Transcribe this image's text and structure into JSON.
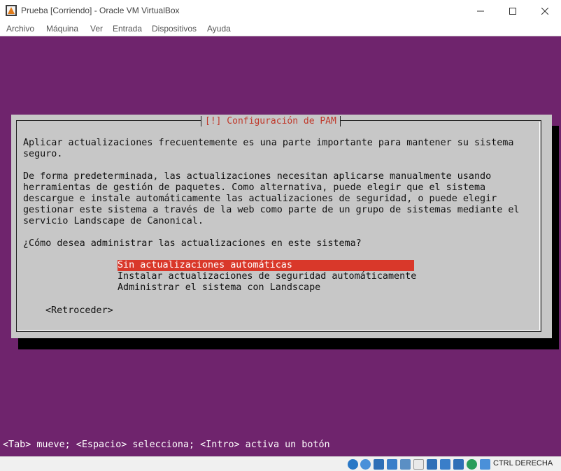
{
  "window": {
    "title": "Prueba [Corriendo] - Oracle VM VirtualBox",
    "minimize_glyph": "─",
    "maximize_glyph": "☐",
    "close_glyph": "✕"
  },
  "menu": {
    "items": [
      "Archivo",
      "Máquina",
      "Ver",
      "Entrada",
      "Dispositivos",
      "Ayuda"
    ]
  },
  "dialog": {
    "title": "[!] Configuración de PAM",
    "paragraph1": "Aplicar actualizaciones frecuentemente es una parte importante para mantener su sistema\nseguro.",
    "paragraph2": "De forma predeterminada, las actualizaciones necesitan aplicarse manualmente usando\nherramientas de gestión de paquetes. Como alternativa, puede elegir que el sistema\ndescargue e instale automáticamente las actualizaciones de seguridad, o puede elegir\ngestionar este sistema a través de la web como parte de un grupo de sistemas mediante el\nservicio Landscape de Canonical.",
    "question": "¿Cómo desea administrar las actualizaciones en este sistema?",
    "options": [
      "Sin actualizaciones automáticas",
      "Instalar actualizaciones de seguridad automáticamente",
      "Administrar el sistema con Landscape"
    ],
    "selected_option": "Sin actualizaciones automáticas",
    "back_button": "<Retroceder>"
  },
  "footer_hint": "<Tab> mueve; <Espacio> selecciona; <Intro> activa un botón",
  "statusbar": {
    "icons": [
      "hard-disk-icon",
      "optical-drive-icon",
      "audio-icon",
      "network-icon",
      "usb-icon",
      "shared-folders-icon",
      "display-icon",
      "video-capture-icon",
      "virtualization-icon",
      "mouse-integration-icon",
      "keyboard-capture-icon"
    ],
    "host_key": "CTRL DERECHA"
  },
  "colors": {
    "vm_background": "#6f246d",
    "dialog_background": "#c7c7c7",
    "selection": "#d9382a",
    "title_text": "#c0392b"
  }
}
